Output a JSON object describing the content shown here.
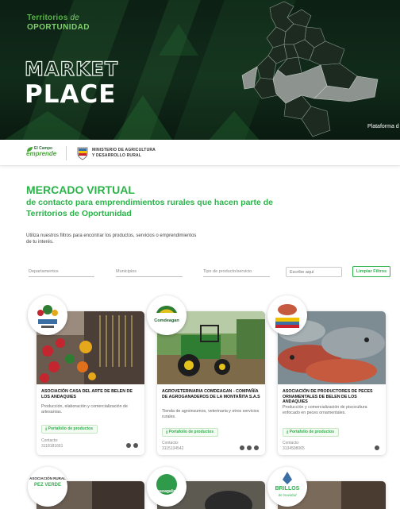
{
  "hero": {
    "logo_line1": "Territorios",
    "logo_de": "de",
    "logo_line2": "OPORTUNIDAD",
    "title_line1": "MARKET",
    "title_line2": "PLACE",
    "caption": "Plataforma d"
  },
  "institutions": {
    "logo1_top": "El Campo",
    "logo1_bottom": "emprende",
    "ministry_line1": "MINISTERIO DE AGRICULTURA",
    "ministry_line2": "Y DESARROLLO RURAL"
  },
  "heading": {
    "main": "MERCADO VIRTUAL",
    "sub": "de contacto para emprendimientos rurales que hacen parte de Territorios de Oportunidad"
  },
  "intro": "Utiliza nuestros filtros para encontrar los productos, servicios o emprendimientos de tu interés.",
  "filters": {
    "departamentos": "Departamentos",
    "municipios": "Municipios",
    "tipo": "Tipo de producto/servicio",
    "search_placeholder": "Escribe aquí",
    "clear_label": "Limpiar Filtros"
  },
  "cards": [
    {
      "title": "ASOCIACIÓN CASA DEL ARTE DE BELEN DE LOS ANDAQUIES",
      "description": "Producción, elaboración y comercialización de artesanías.",
      "portfolio_label": "Portafolio de productos",
      "contact_label": "Contacto:",
      "contact_value": "3118181661",
      "socials": [
        "whatsapp-icon",
        "web-icon"
      ]
    },
    {
      "title": "AGROVETERINARIA COMDEAGAN - COMPAÑÍA DE AGROGANADEROS DE LA MONTAÑITA S.A.S",
      "description": "Tienda de agroinsumos, veterinaria y otros servicios rurales.",
      "portfolio_label": "Portafolio de productos",
      "contact_label": "Contacto:",
      "contact_value": "3115134542",
      "badge_text": "Comdeagan",
      "socials": [
        "whatsapp-icon",
        "facebook-icon",
        "instagram-icon"
      ]
    },
    {
      "title": "ASOCIACIÓN DE PRODUCTORES DE PECES ORNAMENTALES DE BELEN DE LOS ANDAQUIES",
      "description": "Producción y comercialización de piscicultura enfocado en peces ornamentales.",
      "portfolio_label": "Portafolio de productos",
      "contact_label": "Contacto:",
      "contact_value": "3134598065",
      "socials": [
        "whatsapp-icon"
      ]
    }
  ],
  "cards_row2": [
    {
      "badge_text": "ASOCIACIÓN RURAL",
      "badge_text2": "PEZ VERDE"
    },
    {
      "badge_text": "asoagalin"
    },
    {
      "badge_text": "BRILLOS",
      "badge_text2": "de Navidad"
    }
  ],
  "colors": {
    "accent_green": "#2bb34a",
    "hero_dark": "#0c2014"
  }
}
